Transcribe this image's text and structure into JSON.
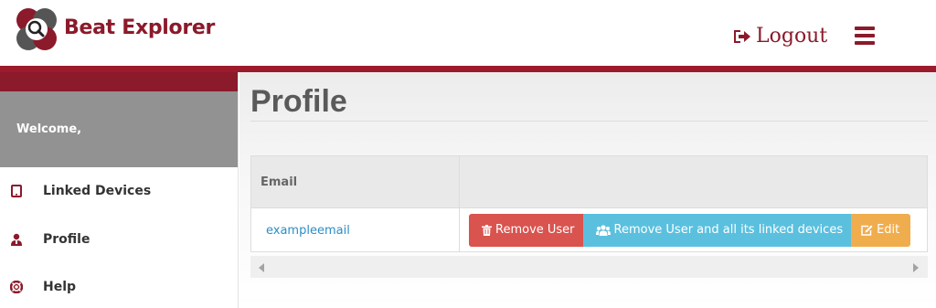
{
  "header": {
    "brand": "Beat Explorer",
    "logout_label": "Logout",
    "logout_icon": "sign-out-icon",
    "menu_icon": "hamburger-menu-icon",
    "brand_color": "#8b1a2b"
  },
  "sidebar": {
    "welcome": "Welcome,",
    "items": [
      {
        "label": "Linked Devices",
        "icon": "tablet-icon"
      },
      {
        "label": "Profile",
        "icon": "user-icon"
      },
      {
        "label": "Help",
        "icon": "life-ring-icon"
      }
    ]
  },
  "main": {
    "title": "Profile",
    "table": {
      "headers": [
        "Email",
        ""
      ],
      "rows": [
        {
          "email": "exampleemail",
          "actions": [
            {
              "label": "Remove User",
              "icon": "trash-icon",
              "color": "#d9534f"
            },
            {
              "label": "Remove User and all its linked devices",
              "icon": "users-icon",
              "color": "#5bc0de"
            },
            {
              "label": "Edit",
              "icon": "edit-icon",
              "color": "#f0ad4e"
            }
          ]
        }
      ]
    }
  }
}
